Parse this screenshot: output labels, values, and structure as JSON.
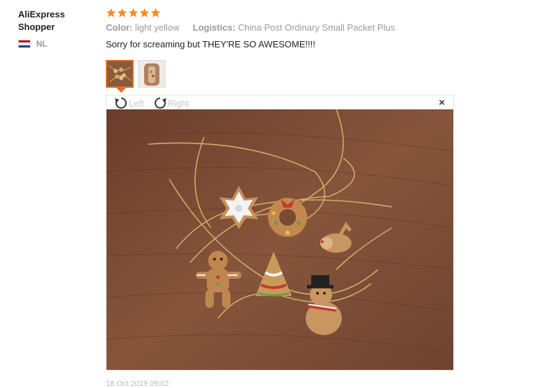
{
  "user": {
    "name": "AliExpress\nShopper",
    "country": "NL"
  },
  "review": {
    "rating": 5,
    "color_label": "Color:",
    "color_value": "light yellow",
    "logistics_label": "Logistics:",
    "logistics_value": "China Post Ordinary Small Packet Plus",
    "text": "Sorry for screaming but THEY'RE SO AWESOME!!!!",
    "date": "18 Oct 2019 09:02"
  },
  "viewer": {
    "rotate_left": "Left",
    "rotate_right": "Right",
    "close": "×"
  },
  "icons": {
    "star": "star-icon",
    "rotate_left": "rotate-left-icon",
    "rotate_right": "rotate-right-icon",
    "close": "close-icon",
    "flag": "netherlands-flag-icon"
  },
  "colors": {
    "star": "#f58a24",
    "accent": "#e66a2c",
    "wood": "#7a4a33",
    "gold": "#c8a860"
  }
}
